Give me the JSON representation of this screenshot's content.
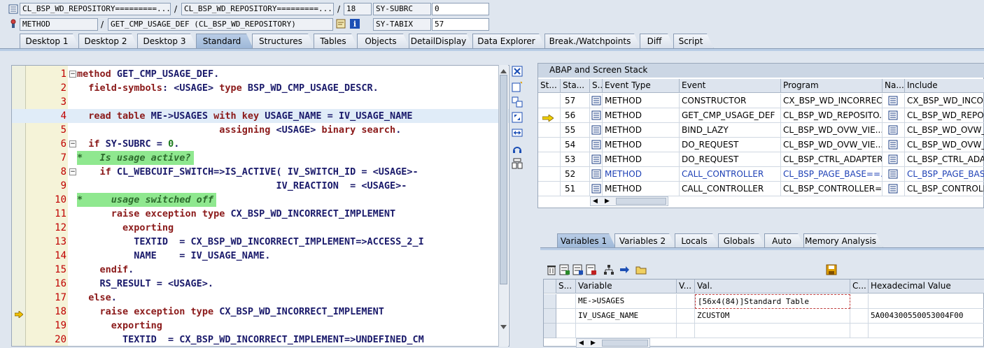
{
  "header": {
    "row1": {
      "program": "CL_BSP_WD_REPOSITORY=========...",
      "include": "CL_BSP_WD_REPOSITORY=========...",
      "line": "18",
      "subrc_label": "SY-SUBRC",
      "subrc_value": "0"
    },
    "row2": {
      "event_type": "METHOD",
      "event": "GET_CMP_USAGE_DEF (CL_BSP_WD_REPOSITORY)",
      "tabix_label": "SY-TABIX",
      "tabix_value": "57"
    },
    "separator": "/"
  },
  "tabs": [
    "Desktop 1",
    "Desktop 2",
    "Desktop 3",
    "Standard",
    "Structures",
    "Tables",
    "Objects",
    "DetailDisplay",
    "Data Explorer",
    "Break./Watchpoints",
    "Diff",
    "Script"
  ],
  "active_tab": "Standard",
  "code": [
    {
      "n": "1",
      "fold": "−",
      "parts": [
        [
          "kw",
          "method "
        ],
        [
          "tx",
          "GET_CMP_USAGE_DEF."
        ]
      ]
    },
    {
      "n": "2",
      "parts": [
        [
          "tx",
          "  "
        ],
        [
          "kw",
          "field-symbols"
        ],
        [
          "tx",
          ": <USAGE> "
        ],
        [
          "kw",
          "type "
        ],
        [
          "tx",
          "BSP_WD_CMP_USAGE_DESCR."
        ]
      ]
    },
    {
      "n": "3",
      "parts": []
    },
    {
      "n": "4",
      "cur": true,
      "parts": [
        [
          "tx",
          "  "
        ],
        [
          "kw",
          "read table "
        ],
        [
          "tx",
          "ME->USAGES "
        ],
        [
          "kw",
          "with key "
        ],
        [
          "tx",
          "USAGE_NAME = IV_USAGE_NAME"
        ]
      ]
    },
    {
      "n": "5",
      "parts": [
        [
          "tx",
          "                         "
        ],
        [
          "kw",
          "assigning "
        ],
        [
          "tx",
          "<USAGE> "
        ],
        [
          "kw",
          "binary search"
        ],
        [
          "tx",
          "."
        ]
      ]
    },
    {
      "n": "6",
      "fold": "−",
      "parts": [
        [
          "tx",
          "  "
        ],
        [
          "kw",
          "if "
        ],
        [
          "tx",
          "SY-SUBRC = "
        ],
        [
          "num",
          "0"
        ],
        [
          "tx",
          "."
        ]
      ]
    },
    {
      "n": "7",
      "comment": true,
      "parts": [
        [
          "cmt",
          "*   Is usage active?"
        ]
      ]
    },
    {
      "n": "8",
      "fold": "−",
      "parts": [
        [
          "tx",
          "    "
        ],
        [
          "kw",
          "if "
        ],
        [
          "tx",
          "CL_WEBCUIF_SWITCH=>IS_ACTIVE( IV_SWITCH_ID = <USAGE>-"
        ]
      ]
    },
    {
      "n": "9",
      "parts": [
        [
          "tx",
          "                                   IV_REACTION  = <USAGE>-"
        ]
      ]
    },
    {
      "n": "10",
      "comment": true,
      "parts": [
        [
          "cmt",
          "*     usage switched off"
        ]
      ]
    },
    {
      "n": "11",
      "parts": [
        [
          "tx",
          "      "
        ],
        [
          "kw",
          "raise exception type "
        ],
        [
          "tx",
          "CX_BSP_WD_INCORRECT_IMPLEMENT"
        ]
      ]
    },
    {
      "n": "12",
      "parts": [
        [
          "tx",
          "        "
        ],
        [
          "kw",
          "exporting"
        ]
      ]
    },
    {
      "n": "13",
      "parts": [
        [
          "tx",
          "          TEXTID  = CX_BSP_WD_INCORRECT_IMPLEMENT=>ACCESS_2_I"
        ]
      ]
    },
    {
      "n": "14",
      "parts": [
        [
          "tx",
          "          NAME    = IV_USAGE_NAME."
        ]
      ]
    },
    {
      "n": "15",
      "parts": [
        [
          "tx",
          "    "
        ],
        [
          "kw",
          "endif"
        ],
        [
          "tx",
          "."
        ]
      ]
    },
    {
      "n": "16",
      "parts": [
        [
          "tx",
          "    RS_RESULT = <USAGE>."
        ]
      ]
    },
    {
      "n": "17",
      "parts": [
        [
          "tx",
          "  "
        ],
        [
          "kw",
          "else"
        ],
        [
          "tx",
          "."
        ]
      ]
    },
    {
      "n": "18",
      "arrow": true,
      "parts": [
        [
          "tx",
          "    "
        ],
        [
          "kw",
          "raise exception type "
        ],
        [
          "tx",
          "CX_BSP_WD_INCORRECT_IMPLEMENT"
        ]
      ]
    },
    {
      "n": "19",
      "parts": [
        [
          "tx",
          "      "
        ],
        [
          "kw",
          "exporting"
        ]
      ]
    },
    {
      "n": "20",
      "parts": [
        [
          "tx",
          "        TEXTID  = CX_BSP_WD_INCORRECT_IMPLEMENT=>UNDEFINED_CM"
        ]
      ]
    }
  ],
  "stack": {
    "title": "ABAP and Screen Stack",
    "columns": [
      "St...",
      "Sta...",
      "S...",
      "Event Type",
      "Event",
      "Program",
      "Na...",
      "Include"
    ],
    "rows": [
      {
        "level": "57",
        "type": "METHOD",
        "event": "CONSTRUCTOR",
        "program": "CX_BSP_WD_INCORREC...",
        "include": "CX_BSP_WD_INCOR"
      },
      {
        "level": "56",
        "type": "METHOD",
        "event": "GET_CMP_USAGE_DEF",
        "program": "CL_BSP_WD_REPOSITO...",
        "include": "CL_BSP_WD_REPOS",
        "current": true
      },
      {
        "level": "55",
        "type": "METHOD",
        "event": "BIND_LAZY",
        "program": "CL_BSP_WD_OVW_VIE...",
        "include": "CL_BSP_WD_OVW_"
      },
      {
        "level": "54",
        "type": "METHOD",
        "event": "DO_REQUEST",
        "program": "CL_BSP_WD_OVW_VIE...",
        "include": "CL_BSP_WD_OVW_"
      },
      {
        "level": "53",
        "type": "METHOD",
        "event": "DO_REQUEST",
        "program": "CL_BSP_CTRL_ADAPTER...",
        "include": "CL_BSP_CTRL_ADAP"
      },
      {
        "level": "52",
        "type": "METHOD",
        "event": "CALL_CONTROLLER",
        "program": "CL_BSP_PAGE_BASE==...",
        "include": "CL_BSP_PAGE_BASE",
        "blue": true
      },
      {
        "level": "51",
        "type": "METHOD",
        "event": "CALL_CONTROLLER",
        "program": "CL_BSP_CONTROLLER=...",
        "include": "CL_BSP_CONTROLLE"
      }
    ]
  },
  "var_tabs": [
    "Variables 1",
    "Variables 2",
    "Locals",
    "Globals",
    "Auto",
    "Memory Analysis"
  ],
  "active_var_tab": "Variables 1",
  "vars": {
    "columns": [
      "S...",
      "Variable",
      "V...",
      "Val.",
      "C...",
      "Hexadecimal Value"
    ],
    "rows": [
      {
        "name": "ME->USAGES",
        "value": "[56x4(84)]Standard Table",
        "hex": ""
      },
      {
        "name": "IV_USAGE_NAME",
        "value": "ZCUSTOM",
        "hex": "5A004300550053004F00"
      }
    ]
  },
  "colors": {
    "keyword": "#8b1a1a",
    "text": "#1a1a6b",
    "comment_bg": "#8fe88f",
    "line_number": "#c00000",
    "active_tab": "#9db7d8"
  }
}
